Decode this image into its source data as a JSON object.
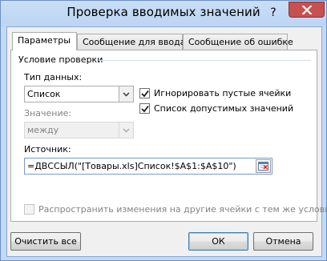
{
  "window": {
    "title": "Проверка вводимых значений",
    "help_glyph": "?"
  },
  "tabs": [
    {
      "label": "Параметры",
      "active": true
    },
    {
      "label": "Сообщение для ввода",
      "active": false
    },
    {
      "label": "Сообщение об ошибке",
      "active": false
    }
  ],
  "settings": {
    "group_label": "Условие проверки",
    "data_type_label": "Тип данных:",
    "data_type_value": "Список",
    "value_label": "Значение:",
    "value_value": "между",
    "ignore_blank": {
      "label": "Игнорировать пустые ячейки",
      "checked": true
    },
    "in_cell_dropdown": {
      "label": "Список допустимых значений",
      "checked": true
    },
    "source_label": "Источник:",
    "source_value": "=ДВССЫЛ(\"[Товары.xls]Список!$A$1:$A$10\")",
    "apply_all": {
      "label": "Распространить изменения на другие ячейки с тем же условием",
      "checked": false
    }
  },
  "buttons": {
    "clear_all": "Очистить все",
    "ok": "ОК",
    "cancel": "Отмена"
  },
  "colors": {
    "frame": "#c3daf5",
    "close_button": "#c75050",
    "default_button_border": "#3c7fb1"
  }
}
